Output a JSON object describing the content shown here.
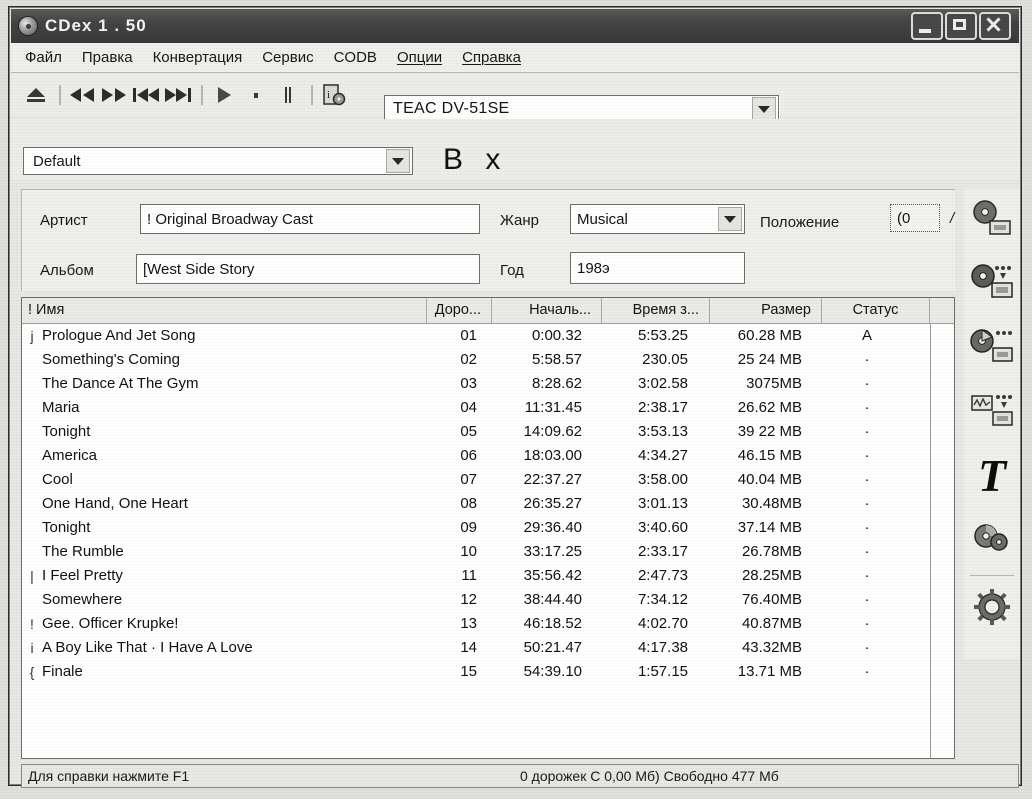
{
  "window": {
    "title": "CDex 1 . 50",
    "icon": "cd-disc-icon",
    "buttons": {
      "minimize": "minimize",
      "maximize": "maximize",
      "close": "close"
    }
  },
  "menu": {
    "items": [
      {
        "label": "Файл",
        "underlined": false
      },
      {
        "label": "Правка",
        "underlined": false
      },
      {
        "label": "Конвертация",
        "underlined": false
      },
      {
        "label": "Сервис",
        "underlined": false
      },
      {
        "label": "CODB",
        "underlined": false
      },
      {
        "label": "Опции",
        "underlined": true
      },
      {
        "label": "Справка",
        "underlined": true
      }
    ]
  },
  "toolbar": {
    "buttons": [
      {
        "name": "eject-icon",
        "tip": "Eject"
      },
      {
        "name": "rewind-icon",
        "tip": "Rewind"
      },
      {
        "name": "fast-forward-icon",
        "tip": "Fast forward"
      },
      {
        "name": "previous-track-icon",
        "tip": "Previous track"
      },
      {
        "name": "next-track-icon",
        "tip": "Next track"
      },
      {
        "name": "play-icon",
        "tip": "Play"
      },
      {
        "name": "stop-icon",
        "tip": "Stop"
      },
      {
        "name": "pause-icon",
        "tip": "Pause"
      },
      {
        "name": "cddb-info-icon",
        "tip": "CDDB info"
      }
    ],
    "device": {
      "brand": "TEAC",
      "model": "DV-51SE",
      "value": "TEAC   DV-51SE"
    },
    "profile": {
      "value": "Default"
    },
    "bx_label": "B x"
  },
  "info": {
    "artist_label": "Артист",
    "artist_value": "! Original Broadway Cast",
    "album_label": "Альбом",
    "album_value": "[West Side Story",
    "genre_label": "Жанр",
    "genre_value": "Musical",
    "year_label": "Год",
    "year_value": "198э",
    "position_label": "Положение",
    "position_value": "(0",
    "position_suffix": "/"
  },
  "tracklist": {
    "columns": [
      {
        "key": "name",
        "label": "! Имя"
      },
      {
        "key": "track",
        "label": "Доро..."
      },
      {
        "key": "start",
        "label": "Началь..."
      },
      {
        "key": "dur",
        "label": "Время з..."
      },
      {
        "key": "size",
        "label": "Размер"
      },
      {
        "key": "status",
        "label": "Статус"
      }
    ],
    "rows": [
      {
        "mark": "j",
        "name": "Prologue And Jet Song",
        "track": "01",
        "start": "0:00.32",
        "dur": "5:53.25",
        "size": "60.28 MB",
        "status": "A"
      },
      {
        "mark": "",
        "name": "Something's Coming",
        "track": "02",
        "start": "5:58.57",
        "dur": "230.05",
        "size": "25 24 MB",
        "status": "·"
      },
      {
        "mark": "",
        "name": "The Dance At The Gym",
        "track": "03",
        "start": "8:28.62",
        "dur": "3:02.58",
        "size": "3075MB",
        "status": "·"
      },
      {
        "mark": "",
        "name": "Maria",
        "track": "04",
        "start": "11:31.45",
        "dur": "2:38.17",
        "size": "26.62 MB",
        "status": "·"
      },
      {
        "mark": "",
        "name": "Tonight",
        "track": "05",
        "start": "14:09.62",
        "dur": "3:53.13",
        "size": "39 22 MB",
        "status": "·"
      },
      {
        "mark": "",
        "name": "America",
        "track": "06",
        "start": "18:03.00",
        "dur": "4:34.27",
        "size": "46.15 MB",
        "status": "·"
      },
      {
        "mark": "",
        "name": "Cool",
        "track": "07",
        "start": "22:37.27",
        "dur": "3:58.00",
        "size": "40.04 MB",
        "status": "·"
      },
      {
        "mark": "",
        "name": "One Hand, One Heart",
        "track": "08",
        "start": "26:35.27",
        "dur": "3:01.13",
        "size": "30.48MB",
        "status": "·"
      },
      {
        "mark": "",
        "name": "Tonight",
        "track": "09",
        "start": "29:36.40",
        "dur": "3:40.60",
        "size": "37.14 MB",
        "status": "·"
      },
      {
        "mark": "",
        "name": "The Rumble",
        "track": "10",
        "start": "33:17.25",
        "dur": "2:33.17",
        "size": "26.78MB",
        "status": "·"
      },
      {
        "mark": "|",
        "name": "I  Feel Pretty",
        "track": "11",
        "start": "35:56.42",
        "dur": "2:47.73",
        "size": "28.25MB",
        "status": "·"
      },
      {
        "mark": "",
        "name": "Somewhere",
        "track": "12",
        "start": "38:44.40",
        "dur": "7:34.12",
        "size": "76.40MB",
        "status": "·"
      },
      {
        "mark": "!",
        "name": "Gee. Officer Krupke!",
        "track": "13",
        "start": "46:18.52",
        "dur": "4:02.70",
        "size": "40.87MB",
        "status": "·"
      },
      {
        "mark": "i",
        "name": "A Boy Like That · I Have A Love",
        "track": "14",
        "start": "50:21.47",
        "dur": "4:17.38",
        "size": "43.32MB",
        "status": "·"
      },
      {
        "mark": "{",
        "name": "Finale",
        "track": "15",
        "start": "54:39.10",
        "dur": "1:57.15",
        "size": "13.71 MB",
        "status": "·"
      }
    ]
  },
  "rail": {
    "buttons": [
      {
        "name": "extract-cd-to-wav-icon",
        "label": "CD to WAV"
      },
      {
        "name": "extract-cd-to-mp3-icon",
        "label": "CD to compressed audio"
      },
      {
        "name": "extract-partial-cd-icon",
        "label": "Partial CD track extraction"
      },
      {
        "name": "convert-wav-to-mp3-icon",
        "label": "WAV to compressed audio"
      },
      {
        "name": "id3-tag-icon",
        "label": "T"
      },
      {
        "name": "cddb-lookup-icon",
        "label": "CDDB"
      },
      {
        "name": "settings-gear-icon",
        "label": "Settings"
      }
    ]
  },
  "statusbar": {
    "hint": "Для справки нажмите F1",
    "info": "0 дорожек С 0,00 Мб) Свободно   477 Мб"
  },
  "colors": {
    "titlebar": "#454545",
    "face": "#ebebe7",
    "field": "#ffffff",
    "text": "#161616",
    "border": "#6d6d6a"
  }
}
